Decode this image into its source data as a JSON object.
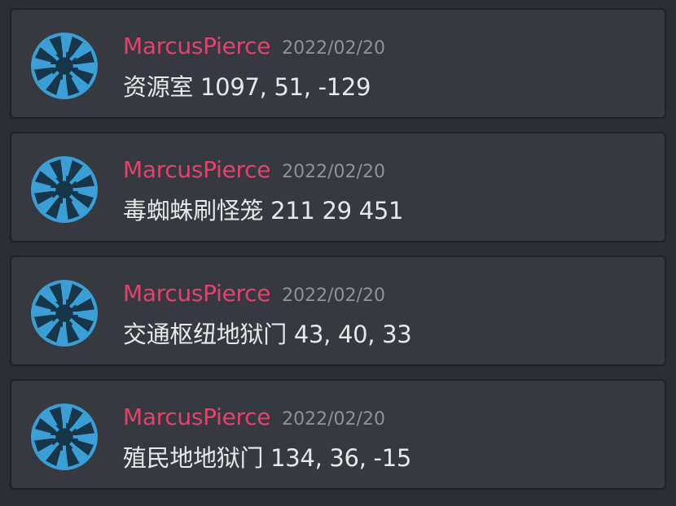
{
  "colors": {
    "background": "#2c2e33",
    "card": "#36393f",
    "card_border": "#202226",
    "author": "#e0446e",
    "timestamp": "#8e9297",
    "text": "#e6e7e8",
    "avatar_blue": "#3b9ed4",
    "avatar_dark": "#17364a"
  },
  "messages": [
    {
      "avatar_icon": "aperture-icon",
      "author": "MarcusPierce",
      "timestamp": "2022/02/20",
      "text": "资源室 1097, 51, -129"
    },
    {
      "avatar_icon": "aperture-icon",
      "author": "MarcusPierce",
      "timestamp": "2022/02/20",
      "text": "毒蜘蛛刷怪笼 211 29 451"
    },
    {
      "avatar_icon": "aperture-icon",
      "author": "MarcusPierce",
      "timestamp": "2022/02/20",
      "text": "交通枢纽地狱门 43, 40, 33"
    },
    {
      "avatar_icon": "aperture-icon",
      "author": "MarcusPierce",
      "timestamp": "2022/02/20",
      "text": "殖民地地狱门 134, 36, -15"
    }
  ]
}
